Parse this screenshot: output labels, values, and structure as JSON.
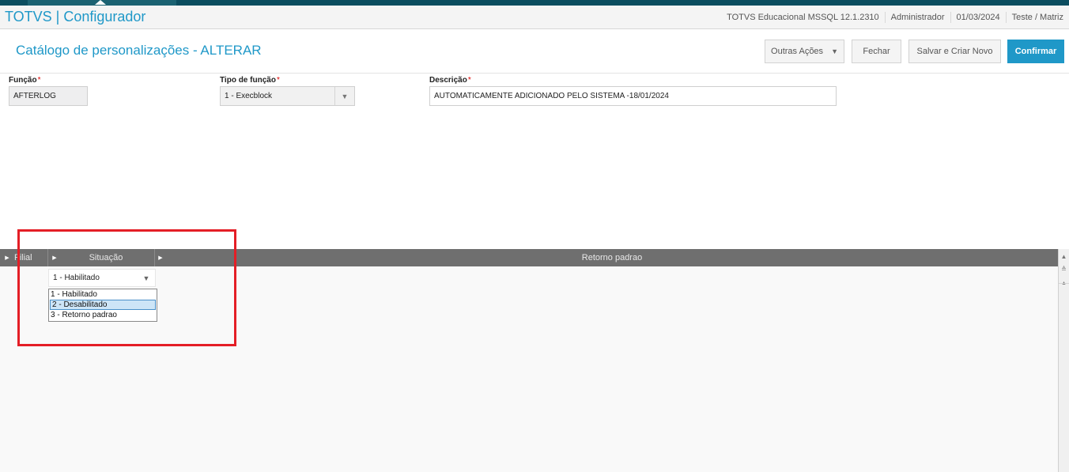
{
  "app": {
    "title": "TOTVS | Configurador",
    "status": [
      "TOTVS Educacional MSSQL 12.1.2310",
      "Administrador",
      "01/03/2024",
      "Teste / Matriz"
    ]
  },
  "page": {
    "title": "Catálogo de personalizações - ALTERAR",
    "buttons": {
      "outras_acoes": "Outras Ações",
      "fechar": "Fechar",
      "salvar_novo": "Salvar e Criar Novo",
      "confirmar": "Confirmar"
    }
  },
  "form": {
    "funcao": {
      "label": "Função",
      "required": "*",
      "value": "AFTERLOG"
    },
    "tipo": {
      "label": "Tipo de função",
      "required": "*",
      "value": "1 - Execblock"
    },
    "descricao": {
      "label": "Descrição",
      "required": "*",
      "value": "AUTOMATICAMENTE ADICIONADO PELO SISTEMA -18/01/2024"
    }
  },
  "grid": {
    "columns": [
      "Filial",
      "Situação",
      "Retorno padrao"
    ],
    "cell_value": "1 - Habilitado",
    "options": [
      "1 - Habilitado",
      "2 - Desabilitado",
      "3 - Retorno padrao"
    ],
    "highlighted_option": "2 - Desabilitado"
  },
  "colors": {
    "accent": "#1f98c8",
    "highlight_border": "#e41e26",
    "grid_header": "#6f6f6f"
  }
}
